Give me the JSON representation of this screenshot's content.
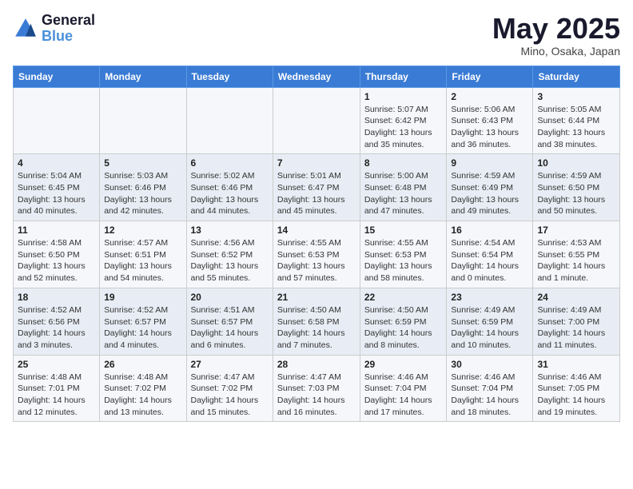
{
  "header": {
    "logo_line1": "General",
    "logo_line2": "Blue",
    "month_year": "May 2025",
    "location": "Mino, Osaka, Japan"
  },
  "weekdays": [
    "Sunday",
    "Monday",
    "Tuesday",
    "Wednesday",
    "Thursday",
    "Friday",
    "Saturday"
  ],
  "weeks": [
    [
      {
        "day": "",
        "info": ""
      },
      {
        "day": "",
        "info": ""
      },
      {
        "day": "",
        "info": ""
      },
      {
        "day": "",
        "info": ""
      },
      {
        "day": "1",
        "info": "Sunrise: 5:07 AM\nSunset: 6:42 PM\nDaylight: 13 hours\nand 35 minutes."
      },
      {
        "day": "2",
        "info": "Sunrise: 5:06 AM\nSunset: 6:43 PM\nDaylight: 13 hours\nand 36 minutes."
      },
      {
        "day": "3",
        "info": "Sunrise: 5:05 AM\nSunset: 6:44 PM\nDaylight: 13 hours\nand 38 minutes."
      }
    ],
    [
      {
        "day": "4",
        "info": "Sunrise: 5:04 AM\nSunset: 6:45 PM\nDaylight: 13 hours\nand 40 minutes."
      },
      {
        "day": "5",
        "info": "Sunrise: 5:03 AM\nSunset: 6:46 PM\nDaylight: 13 hours\nand 42 minutes."
      },
      {
        "day": "6",
        "info": "Sunrise: 5:02 AM\nSunset: 6:46 PM\nDaylight: 13 hours\nand 44 minutes."
      },
      {
        "day": "7",
        "info": "Sunrise: 5:01 AM\nSunset: 6:47 PM\nDaylight: 13 hours\nand 45 minutes."
      },
      {
        "day": "8",
        "info": "Sunrise: 5:00 AM\nSunset: 6:48 PM\nDaylight: 13 hours\nand 47 minutes."
      },
      {
        "day": "9",
        "info": "Sunrise: 4:59 AM\nSunset: 6:49 PM\nDaylight: 13 hours\nand 49 minutes."
      },
      {
        "day": "10",
        "info": "Sunrise: 4:59 AM\nSunset: 6:50 PM\nDaylight: 13 hours\nand 50 minutes."
      }
    ],
    [
      {
        "day": "11",
        "info": "Sunrise: 4:58 AM\nSunset: 6:50 PM\nDaylight: 13 hours\nand 52 minutes."
      },
      {
        "day": "12",
        "info": "Sunrise: 4:57 AM\nSunset: 6:51 PM\nDaylight: 13 hours\nand 54 minutes."
      },
      {
        "day": "13",
        "info": "Sunrise: 4:56 AM\nSunset: 6:52 PM\nDaylight: 13 hours\nand 55 minutes."
      },
      {
        "day": "14",
        "info": "Sunrise: 4:55 AM\nSunset: 6:53 PM\nDaylight: 13 hours\nand 57 minutes."
      },
      {
        "day": "15",
        "info": "Sunrise: 4:55 AM\nSunset: 6:53 PM\nDaylight: 13 hours\nand 58 minutes."
      },
      {
        "day": "16",
        "info": "Sunrise: 4:54 AM\nSunset: 6:54 PM\nDaylight: 14 hours\nand 0 minutes."
      },
      {
        "day": "17",
        "info": "Sunrise: 4:53 AM\nSunset: 6:55 PM\nDaylight: 14 hours\nand 1 minute."
      }
    ],
    [
      {
        "day": "18",
        "info": "Sunrise: 4:52 AM\nSunset: 6:56 PM\nDaylight: 14 hours\nand 3 minutes."
      },
      {
        "day": "19",
        "info": "Sunrise: 4:52 AM\nSunset: 6:57 PM\nDaylight: 14 hours\nand 4 minutes."
      },
      {
        "day": "20",
        "info": "Sunrise: 4:51 AM\nSunset: 6:57 PM\nDaylight: 14 hours\nand 6 minutes."
      },
      {
        "day": "21",
        "info": "Sunrise: 4:50 AM\nSunset: 6:58 PM\nDaylight: 14 hours\nand 7 minutes."
      },
      {
        "day": "22",
        "info": "Sunrise: 4:50 AM\nSunset: 6:59 PM\nDaylight: 14 hours\nand 8 minutes."
      },
      {
        "day": "23",
        "info": "Sunrise: 4:49 AM\nSunset: 6:59 PM\nDaylight: 14 hours\nand 10 minutes."
      },
      {
        "day": "24",
        "info": "Sunrise: 4:49 AM\nSunset: 7:00 PM\nDaylight: 14 hours\nand 11 minutes."
      }
    ],
    [
      {
        "day": "25",
        "info": "Sunrise: 4:48 AM\nSunset: 7:01 PM\nDaylight: 14 hours\nand 12 minutes."
      },
      {
        "day": "26",
        "info": "Sunrise: 4:48 AM\nSunset: 7:02 PM\nDaylight: 14 hours\nand 13 minutes."
      },
      {
        "day": "27",
        "info": "Sunrise: 4:47 AM\nSunset: 7:02 PM\nDaylight: 14 hours\nand 15 minutes."
      },
      {
        "day": "28",
        "info": "Sunrise: 4:47 AM\nSunset: 7:03 PM\nDaylight: 14 hours\nand 16 minutes."
      },
      {
        "day": "29",
        "info": "Sunrise: 4:46 AM\nSunset: 7:04 PM\nDaylight: 14 hours\nand 17 minutes."
      },
      {
        "day": "30",
        "info": "Sunrise: 4:46 AM\nSunset: 7:04 PM\nDaylight: 14 hours\nand 18 minutes."
      },
      {
        "day": "31",
        "info": "Sunrise: 4:46 AM\nSunset: 7:05 PM\nDaylight: 14 hours\nand 19 minutes."
      }
    ]
  ]
}
